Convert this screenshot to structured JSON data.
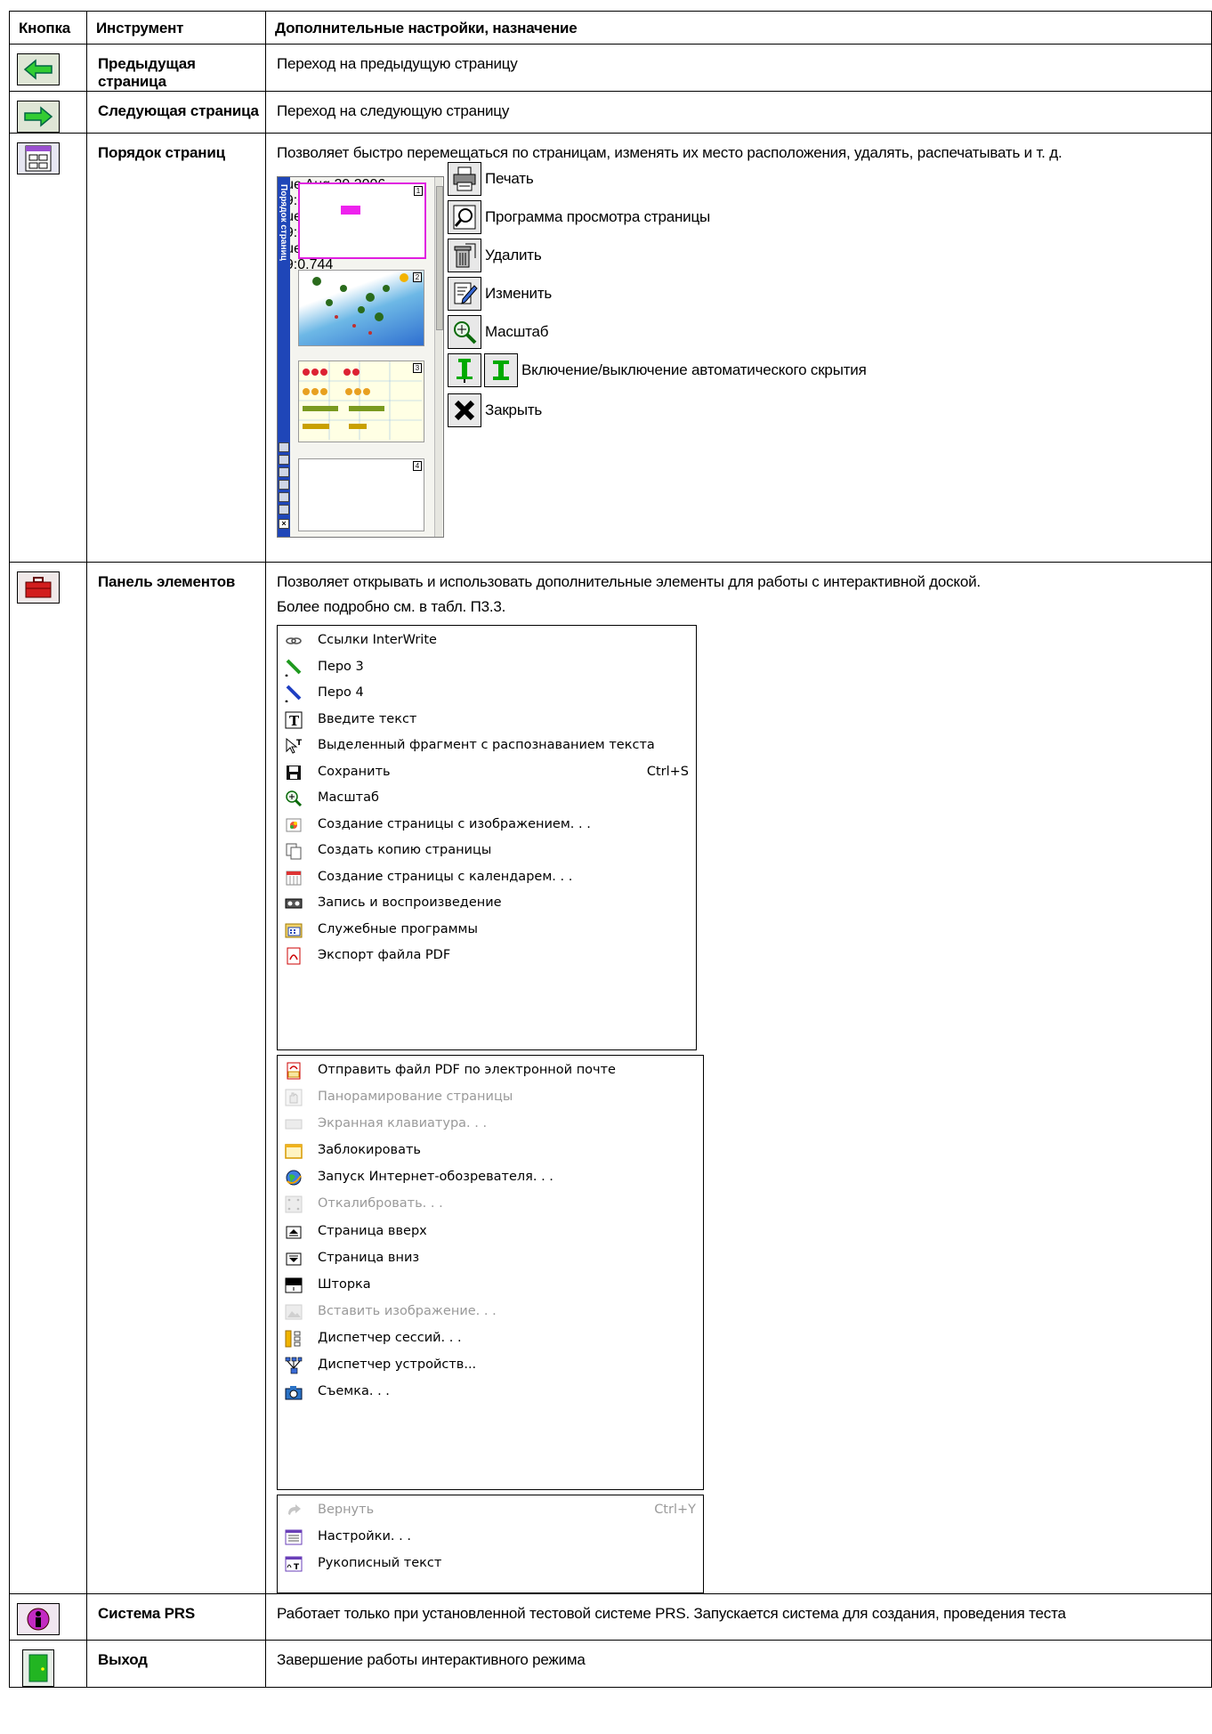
{
  "header": {
    "col1": "Кнопка",
    "col2": "Инструмент",
    "col3": "Дополнительные настройки, назначение"
  },
  "rows": [
    {
      "tool": "Предыдущая страница",
      "desc": "Переход на предыдущую страницу",
      "icon": "left-arrow-icon"
    },
    {
      "tool": "Следующая страница",
      "desc": "Переход на следующую страницу",
      "icon": "right-arrow-icon"
    },
    {
      "tool": "Порядок страниц",
      "desc": "Позволяет быстро перемещаться по страницам, изменять их место расположения, удалять, распечатывать и т. д.",
      "icon": "page-order-icon"
    },
    {
      "tool": "Панель элементов",
      "desc": "Позволяет открывать и использовать дополнительные элементы для работы с интерактивной доской.",
      "desc2": "Более подробно см. в табл. П3.3.",
      "icon": "toolbox-icon"
    },
    {
      "tool": "Система PRS",
      "desc": "Работает только при установленной тестовой системе PRS. Запускается система для создания, проведения теста",
      "icon": "prs-icon"
    },
    {
      "tool": "Выход",
      "desc": "Завершение работы интерактивного режима",
      "icon": "exit-door-icon"
    }
  ],
  "page_order": {
    "panel_title": "Порядок страниц",
    "thumb_numbers": [
      "1",
      "2",
      "3",
      "4"
    ],
    "thumb_date": "Tue Aug 29 2006 09:0.744",
    "tools": [
      {
        "label": "Печать",
        "icon": "printer-icon"
      },
      {
        "label": "Программа просмотра страницы",
        "icon": "magnifier-page-icon"
      },
      {
        "label": "Удалить",
        "icon": "trash-icon"
      },
      {
        "label": "Изменить",
        "icon": "edit-icon"
      },
      {
        "label": "Масштаб",
        "icon": "zoom-icon"
      },
      {
        "label": "Включение/выключение автоматического скрытия",
        "icon": "pin-icon"
      },
      {
        "label": "Закрыть",
        "icon": "close-icon"
      }
    ]
  },
  "menu1": [
    {
      "label": "Ссылки InterWrite",
      "icon": "link-icon"
    },
    {
      "label": "Перо 3",
      "icon": "pen-green-icon"
    },
    {
      "label": "Перо 4",
      "icon": "pen-blue-icon"
    },
    {
      "label": "Введите текст",
      "icon": "text-icon"
    },
    {
      "label": "Выделенный фрагмент с распознаванием текста",
      "icon": "select-recognize-icon"
    },
    {
      "label": "Сохранить",
      "shortcut": "Ctrl+S",
      "icon": "save-icon"
    },
    {
      "label": "Масштаб",
      "icon": "zoom-icon"
    },
    {
      "label": "Создание страницы с изображением. . .",
      "icon": "image-page-icon"
    },
    {
      "label": "Создать копию страницы",
      "icon": "copy-page-icon"
    },
    {
      "label": "Создание страницы с календарем. . .",
      "icon": "calendar-icon"
    },
    {
      "label": "Запись и воспроизведение",
      "icon": "recorder-icon"
    },
    {
      "label": "Служебные программы",
      "icon": "utilities-icon"
    },
    {
      "label": "Экспорт файла PDF",
      "icon": "pdf-icon"
    }
  ],
  "menu2": [
    {
      "label": "Отправить файл PDF по электронной почте",
      "icon": "pdf-mail-icon",
      "disabled": false
    },
    {
      "label": "Панорамирование страницы",
      "icon": "hand-icon",
      "disabled": true
    },
    {
      "label": "Экранная клавиатура. . .",
      "icon": "keyboard-icon",
      "disabled": true
    },
    {
      "label": "Заблокировать",
      "icon": "lock-window-icon",
      "disabled": false
    },
    {
      "label": "Запуск Интернет-обозревателя. . .",
      "icon": "globe-icon",
      "disabled": false
    },
    {
      "label": "Откалибровать. . .",
      "icon": "calibrate-icon",
      "disabled": true
    },
    {
      "label": "Страница вверх",
      "icon": "page-up-icon",
      "disabled": false
    },
    {
      "label": "Страница вниз",
      "icon": "page-down-icon",
      "disabled": false
    },
    {
      "label": "Шторка",
      "icon": "curtain-icon",
      "disabled": false
    },
    {
      "label": "Вставить изображение. . .",
      "icon": "insert-image-icon",
      "disabled": true
    },
    {
      "label": "Диспетчер сессий. . .",
      "icon": "session-icon",
      "disabled": false
    },
    {
      "label": "Диспетчер устройств...",
      "icon": "devices-icon",
      "disabled": false
    },
    {
      "label": "Съемка. . .",
      "icon": "camera-icon",
      "disabled": false
    }
  ],
  "menu3": [
    {
      "label": "Вернуть",
      "shortcut": "Ctrl+Y",
      "icon": "redo-icon",
      "disabled": true
    },
    {
      "label": "Настройки. . .",
      "icon": "settings-icon",
      "disabled": false
    },
    {
      "label": "Рукописный текст",
      "icon": "handwriting-icon",
      "disabled": false
    }
  ]
}
